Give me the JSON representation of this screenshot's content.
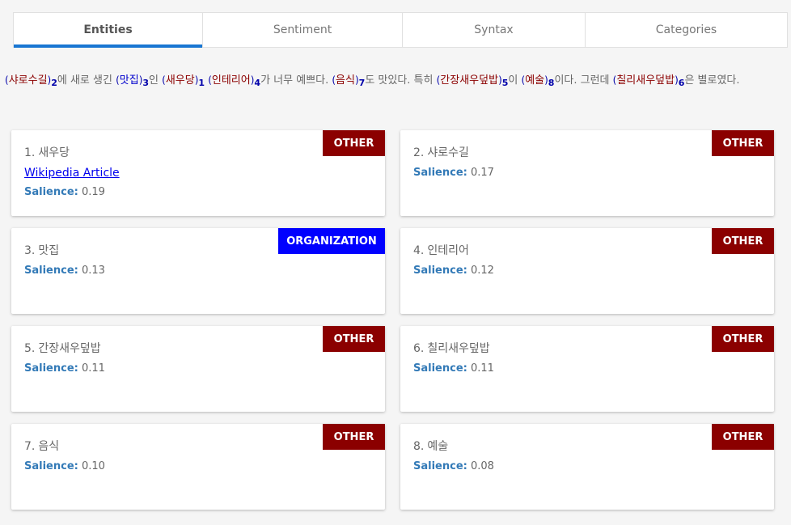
{
  "tabs": [
    {
      "label": "Entities",
      "active": true
    },
    {
      "label": "Sentiment",
      "active": false
    },
    {
      "label": "Syntax",
      "active": false
    },
    {
      "label": "Categories",
      "active": false
    }
  ],
  "sentence": {
    "segments": [
      {
        "entity": "샤로수길",
        "index": "2"
      },
      {
        "text": "에 새로 생긴 "
      },
      {
        "entity": "맛집",
        "index": "3",
        "type": "org"
      },
      {
        "text": "인 "
      },
      {
        "entity": "새우당",
        "index": "1"
      },
      {
        "text": " "
      },
      {
        "entity": "인테리어",
        "index": "4"
      },
      {
        "text": "가 너무 예쁘다. "
      },
      {
        "entity": "음식",
        "index": "7"
      },
      {
        "text": "도 맛있다. 특히 "
      },
      {
        "entity": "간장새우덮밥",
        "index": "5"
      },
      {
        "text": "이 "
      },
      {
        "entity": "예술",
        "index": "8"
      },
      {
        "text": "이다. 그런데 "
      },
      {
        "entity": "칠리새우덮밥",
        "index": "6"
      },
      {
        "text": "은 별로였다."
      }
    ]
  },
  "salience_label": "Salience:",
  "entities": [
    {
      "num": "1.",
      "name": "새우당",
      "wiki": "Wikipedia Article",
      "salience": "0.19",
      "type": "OTHER"
    },
    {
      "num": "2.",
      "name": "샤로수길",
      "salience": "0.17",
      "type": "OTHER"
    },
    {
      "num": "3.",
      "name": "맛집",
      "salience": "0.13",
      "type": "ORGANIZATION"
    },
    {
      "num": "4.",
      "name": "인테리어",
      "salience": "0.12",
      "type": "OTHER"
    },
    {
      "num": "5.",
      "name": "간장새우덮밥",
      "salience": "0.11",
      "type": "OTHER"
    },
    {
      "num": "6.",
      "name": "칠리새우덮밥",
      "salience": "0.11",
      "type": "OTHER"
    },
    {
      "num": "7.",
      "name": "음식",
      "salience": "0.10",
      "type": "OTHER"
    },
    {
      "num": "8.",
      "name": "예술",
      "salience": "0.08",
      "type": "OTHER"
    }
  ],
  "colors": {
    "other_badge": "#8b0000",
    "organization_badge": "#0000ff",
    "tab_active_underline": "#1976d2",
    "salience_label": "#337ab7"
  }
}
